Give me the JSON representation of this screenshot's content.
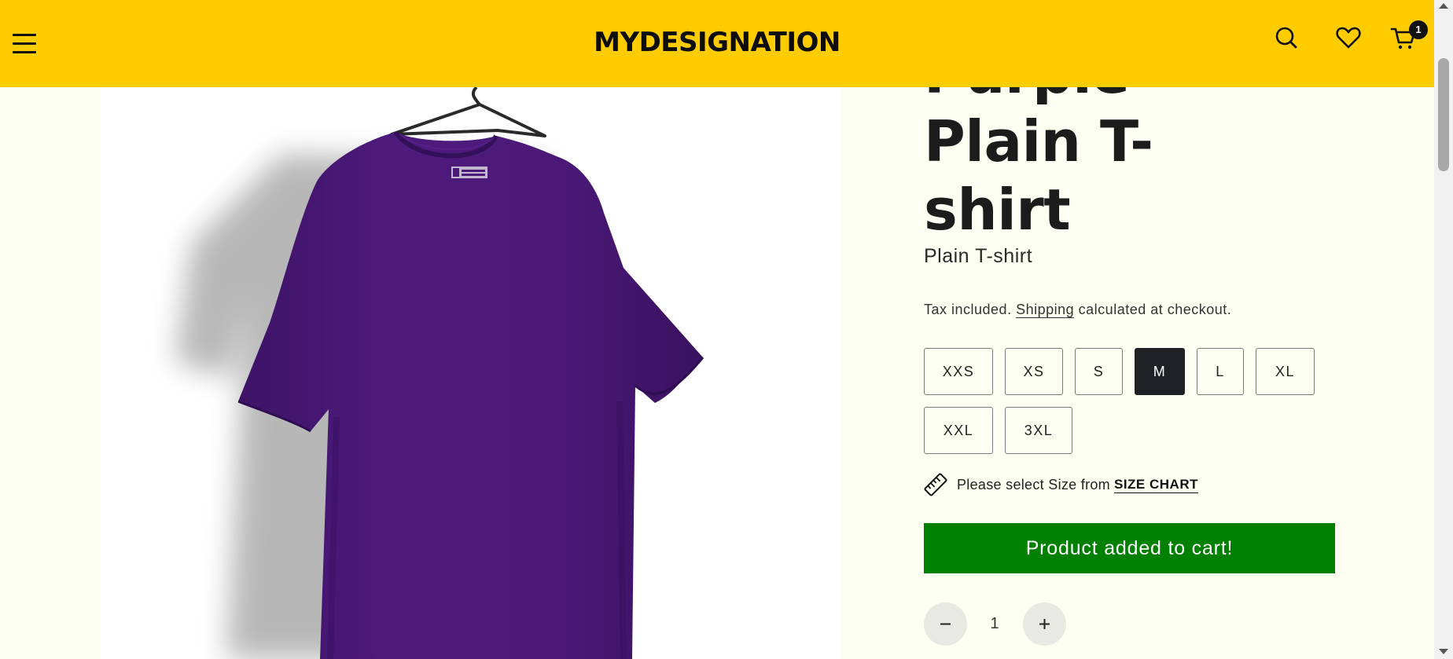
{
  "header": {
    "logo": "MYDESIGNATION",
    "cart_count": "1",
    "background": "#ffcc00",
    "icons": [
      "hamburger-menu-icon",
      "search-icon",
      "heart-icon",
      "cart-icon"
    ]
  },
  "product": {
    "title_lines": [
      "Purple",
      "Plain T-",
      "shirt"
    ],
    "subtitle": "Plain T-shirt",
    "tax_prefix": "Tax included.",
    "shipping_link": "Shipping",
    "tax_suffix": "calculated at checkout.",
    "image_color": "#4b1a78",
    "sizes": [
      {
        "label": "XXS",
        "selected": false
      },
      {
        "label": "XS",
        "selected": false
      },
      {
        "label": "S",
        "selected": false
      },
      {
        "label": "M",
        "selected": true
      },
      {
        "label": "L",
        "selected": false
      },
      {
        "label": "XL",
        "selected": false
      },
      {
        "label": "XXL",
        "selected": false
      },
      {
        "label": "3XL",
        "selected": false
      }
    ],
    "size_chart_text": "Please select Size from",
    "size_chart_link": "SIZE CHART",
    "add_to_cart_label": "Product added to cart!",
    "add_to_cart_color": "#008000",
    "quantity": "1"
  }
}
